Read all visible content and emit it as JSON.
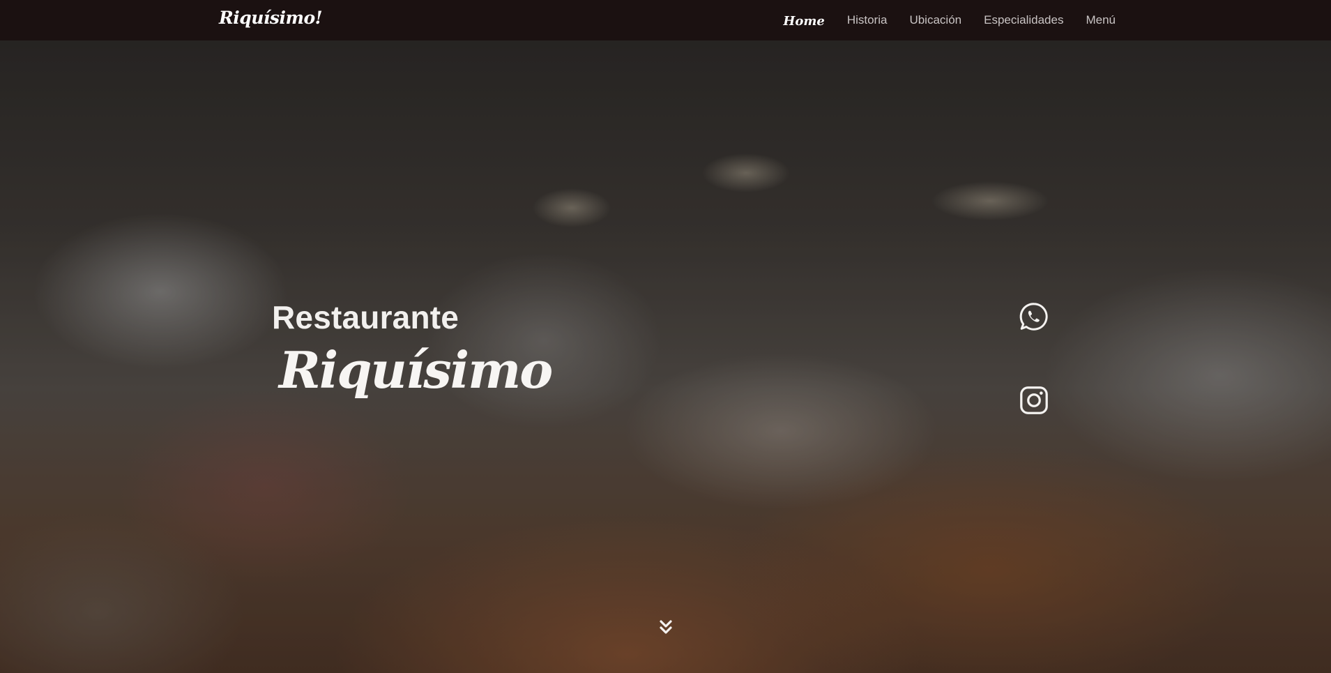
{
  "navbar": {
    "brand": "Riquísimo!",
    "links": [
      {
        "label": "Home",
        "active": true
      },
      {
        "label": "Historia",
        "active": false
      },
      {
        "label": "Ubicación",
        "active": false
      },
      {
        "label": "Especialidades",
        "active": false
      },
      {
        "label": "Menú",
        "active": false
      }
    ]
  },
  "hero": {
    "title": "Restaurante",
    "name": "Riquísimo"
  },
  "social": {
    "whatsapp_icon": "whatsapp-icon",
    "instagram_icon": "instagram-icon"
  },
  "scroll": {
    "icon": "double-chevron-down-icon"
  },
  "colors": {
    "navbar_bg": "#1b1111",
    "text_primary": "#ffffff",
    "nav_text": "#c9c4c4"
  }
}
